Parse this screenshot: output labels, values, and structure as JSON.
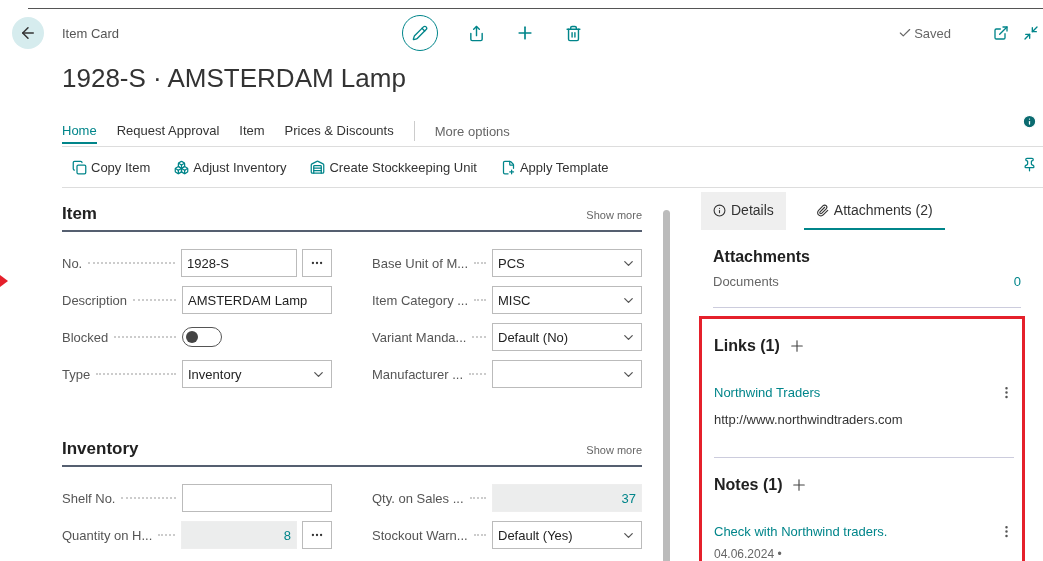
{
  "page": {
    "caption": "Item Card",
    "title": "1928-S · AMSTERDAM Lamp",
    "status": "Saved"
  },
  "tabs": [
    {
      "label": "Home",
      "selected": true
    },
    {
      "label": "Request Approval",
      "selected": false
    },
    {
      "label": "Item",
      "selected": false
    },
    {
      "label": "Prices & Discounts",
      "selected": false
    }
  ],
  "more_options": "More options",
  "commands": [
    {
      "label": "Copy Item",
      "kind": "copy"
    },
    {
      "label": "Adjust Inventory",
      "kind": "adjust"
    },
    {
      "label": "Create Stockkeeping Unit",
      "kind": "sku"
    },
    {
      "label": "Apply Template",
      "kind": "template"
    }
  ],
  "sections": [
    {
      "title": "Item",
      "show_more": "Show more",
      "left": [
        {
          "label": "No.",
          "kind": "text",
          "value": "1928-S",
          "lookup": true
        },
        {
          "label": "Description",
          "kind": "text",
          "value": "AMSTERDAM Lamp",
          "lookup": false
        },
        {
          "label": "Blocked",
          "kind": "toggle",
          "on": false
        },
        {
          "label": "Type",
          "kind": "dropdown",
          "value": "Inventory"
        }
      ],
      "right": [
        {
          "label": "Base Unit of M...",
          "kind": "dropdown",
          "value": "PCS"
        },
        {
          "label": "Item Category ...",
          "kind": "dropdown",
          "value": "MISC"
        },
        {
          "label": "Variant Manda...",
          "kind": "dropdown",
          "value": "Default (No)"
        },
        {
          "label": "Manufacturer ...",
          "kind": "dropdown"
        }
      ]
    },
    {
      "title": "Inventory",
      "show_more": "Show more",
      "left": [
        {
          "label": "Shelf No.",
          "kind": "text",
          "lookup": false
        },
        {
          "label": "Quantity on H...",
          "kind": "readonly",
          "value": "8",
          "lookup": true
        }
      ],
      "right": [
        {
          "label": "Qty. on Sales ...",
          "kind": "readonly",
          "value": "37"
        },
        {
          "label": "Stockout Warn...",
          "kind": "dropdown",
          "value": "Default (Yes)"
        }
      ]
    }
  ],
  "factbox": {
    "tabs": [
      {
        "label": "Details",
        "selected": false
      },
      {
        "label": "Attachments (2)",
        "selected": true
      }
    ],
    "attachments": {
      "title": "Attachments",
      "rows": [
        {
          "label": "Documents",
          "value": "0"
        }
      ]
    },
    "links": {
      "title": "Links (1)",
      "items": [
        {
          "title": "Northwind Traders",
          "url": "http://www.northwindtraders.com"
        }
      ]
    },
    "notes": {
      "title": "Notes (1)",
      "items": [
        {
          "text": "Check with Northwind traders.",
          "date": "04.06.2024 •"
        }
      ]
    }
  }
}
